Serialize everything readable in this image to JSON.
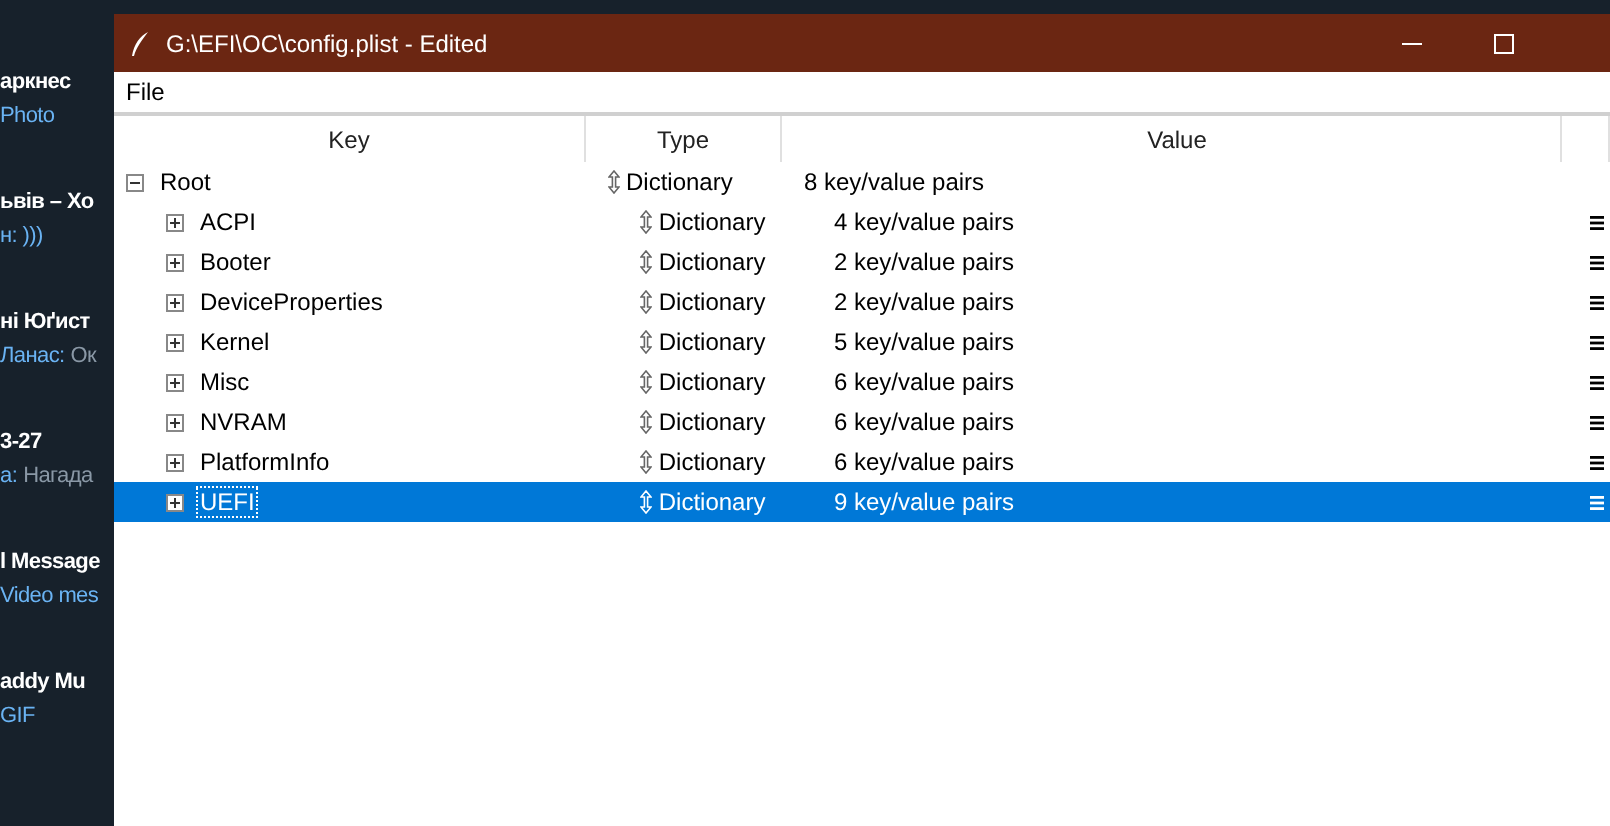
{
  "chats": [
    {
      "title": "аркнес",
      "preview": [
        {
          "text": "Photo",
          "kind": "media"
        }
      ]
    },
    {
      "title": "ьвів – Хо",
      "preview": [
        {
          "text": "н: )))",
          "kind": "sender"
        }
      ]
    },
    {
      "title": "ні Юґист",
      "preview": [
        {
          "text": "Ланас:",
          "kind": "sender"
        },
        {
          "text": "Ок",
          "kind": "text"
        }
      ]
    },
    {
      "title": "3-27",
      "preview": [
        {
          "text": "а:",
          "kind": "sender"
        },
        {
          "text": "Нагада",
          "kind": "text"
        }
      ]
    },
    {
      "title": "l Message",
      "preview": [
        {
          "text": "Video mes",
          "kind": "media"
        }
      ]
    },
    {
      "title": "addy Mu",
      "preview": [
        {
          "text": "GIF",
          "kind": "media"
        }
      ]
    }
  ],
  "window": {
    "title": "G:\\EFI\\OC\\config.plist - Edited"
  },
  "menu": [
    "File"
  ],
  "table": {
    "columns": [
      "Key",
      "Type",
      "Value"
    ],
    "rows": [
      {
        "key": "Root",
        "type": "Dictionary",
        "value": "8 key/value pairs",
        "expanded": true,
        "selected": false,
        "children": [
          {
            "key": "ACPI",
            "type": "Dictionary",
            "value": "4 key/value pairs",
            "expanded": false,
            "selected": false
          },
          {
            "key": "Booter",
            "type": "Dictionary",
            "value": "2 key/value pairs",
            "expanded": false,
            "selected": false
          },
          {
            "key": "DeviceProperties",
            "type": "Dictionary",
            "value": "2 key/value pairs",
            "expanded": false,
            "selected": false
          },
          {
            "key": "Kernel",
            "type": "Dictionary",
            "value": "5 key/value pairs",
            "expanded": false,
            "selected": false
          },
          {
            "key": "Misc",
            "type": "Dictionary",
            "value": "6 key/value pairs",
            "expanded": false,
            "selected": false
          },
          {
            "key": "NVRAM",
            "type": "Dictionary",
            "value": "6 key/value pairs",
            "expanded": false,
            "selected": false
          },
          {
            "key": "PlatformInfo",
            "type": "Dictionary",
            "value": "6 key/value pairs",
            "expanded": false,
            "selected": false
          },
          {
            "key": "UEFI",
            "type": "Dictionary",
            "value": "9 key/value pairs",
            "expanded": false,
            "selected": true
          }
        ]
      }
    ]
  }
}
